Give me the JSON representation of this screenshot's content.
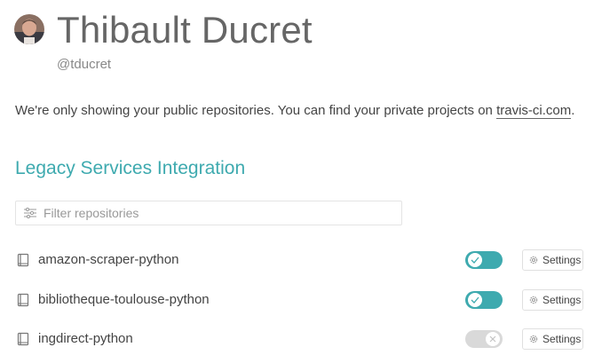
{
  "profile": {
    "name": "Thibault Ducret",
    "handle": "@tducret"
  },
  "notice": {
    "text": "We're only showing your public repositories. You can find your private projects on ",
    "link_label": "travis-ci.com",
    "suffix": "."
  },
  "section": {
    "title": "Legacy Services Integration"
  },
  "filter": {
    "placeholder": "Filter repositories",
    "value": "",
    "icon": "sliders-icon"
  },
  "repositories": [
    {
      "name": "amazon-scraper-python",
      "enabled": true,
      "settings_label": "Settings"
    },
    {
      "name": "bibliotheque-toulouse-python",
      "enabled": true,
      "settings_label": "Settings"
    },
    {
      "name": "ingdirect-python",
      "enabled": false,
      "settings_label": "Settings"
    }
  ],
  "colors": {
    "accent": "#3eaaaf",
    "toggle_off": "#d9d9d9",
    "title_gray": "#666666"
  }
}
